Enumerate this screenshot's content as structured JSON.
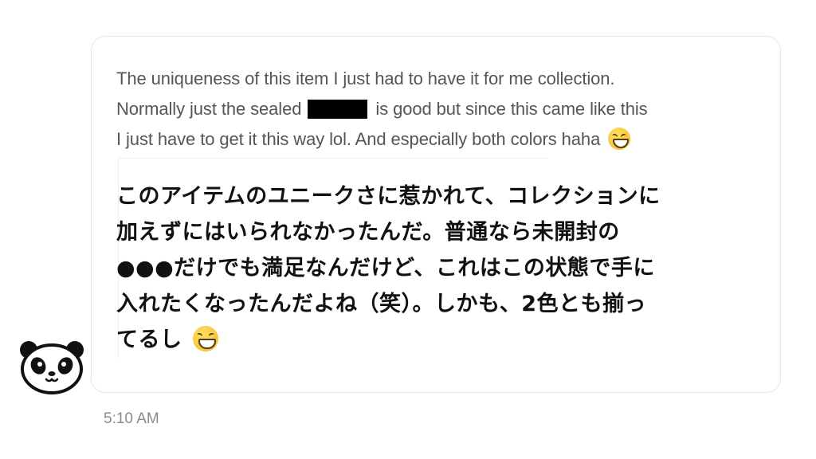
{
  "message": {
    "original_text": {
      "line1": "The uniqueness of this item I just had to have it for me collection.",
      "line2_before": "Normally just the sealed",
      "line2_after": "is good but since this came like this",
      "line3": "I just have to get it this way lol. And especially both colors haha"
    },
    "translation_text": {
      "line1": "このアイテムのユニークさに惹かれて、コレクションに",
      "line2": "加えずにはいられなかったんだ。普通なら未開封の",
      "line3": "●●●だけでも満足なんだけど、これはこの状態で手に",
      "line4": "入れたくなったんだよね（笑）。しかも、2色とも揃っ",
      "line5": "てるし"
    },
    "emoji": "grinning-squinting-face",
    "timestamp": "5:10 AM"
  },
  "sender": {
    "avatar_icon": "panda-icon"
  },
  "colors": {
    "bubble_border": "#e6e6e6",
    "original_text": "#555555",
    "translation_text": "#111111",
    "timestamp": "#8a8a8a",
    "redaction": "#000000"
  }
}
